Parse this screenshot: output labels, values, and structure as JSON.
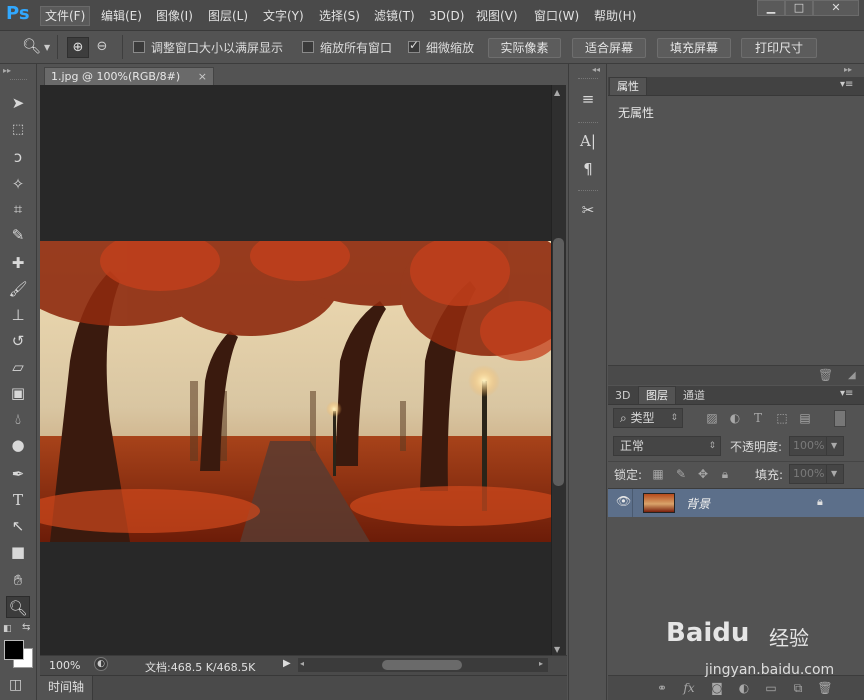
{
  "app": {
    "logo": "Ps"
  },
  "menu": [
    {
      "label": "文件(F)",
      "active": true
    },
    {
      "label": "编辑(E)"
    },
    {
      "label": "图像(I)"
    },
    {
      "label": "图层(L)"
    },
    {
      "label": "文字(Y)"
    },
    {
      "label": "选择(S)"
    },
    {
      "label": "滤镜(T)"
    },
    {
      "label": "3D(D)"
    },
    {
      "label": "视图(V)"
    },
    {
      "label": "窗口(W)"
    },
    {
      "label": "帮助(H)"
    }
  ],
  "window_controls": {
    "minimize": "▁",
    "maximize": "□",
    "close": "✕"
  },
  "options_bar": {
    "resize_windows_label": "调整窗口大小以满屏显示",
    "resize_windows_checked": false,
    "zoom_all_label": "缩放所有窗口",
    "zoom_all_checked": false,
    "scrubby_label": "细微缩放",
    "scrubby_checked": true,
    "actual_pixels": "实际像素",
    "fit_screen": "适合屏幕",
    "fill_screen": "填充屏幕",
    "print_size": "打印尺寸"
  },
  "document": {
    "tab_title": "1.jpg @ 100%(RGB/8#)",
    "tab_close": "×",
    "zoom": "100%",
    "doc_info": "文档:468.5 K/468.5K"
  },
  "timeline": {
    "label": "时间轴"
  },
  "properties_panel": {
    "title": "属性",
    "content": "无属性"
  },
  "layers_panel": {
    "tabs": [
      "3D",
      "图层",
      "通道"
    ],
    "active_tab": "图层",
    "filter_label": "类型",
    "blend_mode": "正常",
    "opacity_label": "不透明度:",
    "opacity_value": "100%",
    "lock_label": "锁定:",
    "fill_label": "填充:",
    "fill_value": "100%",
    "layers": [
      {
        "name": "背景",
        "locked": true,
        "visible": true
      }
    ]
  },
  "watermark": {
    "brand": "Baidu",
    "sub": "经验",
    "url": "jingyan.baidu.com"
  },
  "colors": {
    "accent": "#31a8ff",
    "selected_layer": "#5c6f8a"
  }
}
